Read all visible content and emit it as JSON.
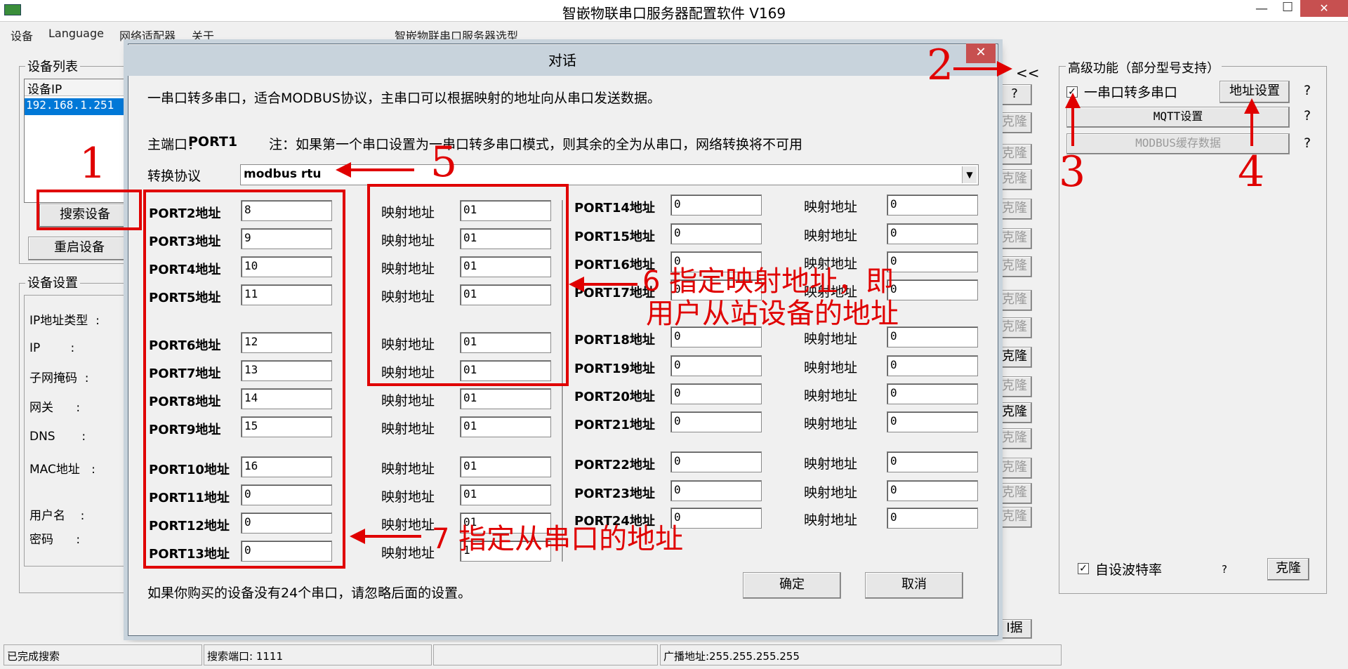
{
  "window": {
    "title": "智嵌物联串口服务器配置软件   V169",
    "controls": [
      "—",
      "☐",
      "✕"
    ]
  },
  "menu": {
    "items": [
      "设备",
      "Language",
      "网络适配器",
      "关于"
    ],
    "center_item": "智嵌物联串口服务器选型"
  },
  "left": {
    "device_list_label": "设备列表",
    "list_header": "设备IP",
    "device_ip": "192.168.1.251",
    "search_button": "搜索设备",
    "restart_button": "重启设备",
    "settings_label": "设备设置",
    "fields": [
      "IP地址类型  :",
      "IP        :",
      "子网掩码  :",
      "网关      :",
      "DNS       :",
      "MAC地址   :",
      "用户名    :",
      "密码      :"
    ]
  },
  "right": {
    "collapse_button": "<<",
    "advanced_label": "高级功能（部分型号支持）",
    "serial_to_multi_label": "一串口转多串口",
    "address_settings_button": "地址设置",
    "mqtt_button": "MQTT设置",
    "modbus_cache_button": "MODBUS缓存数据",
    "help": "?",
    "auto_baud_label": "自设波特率",
    "clone_button": "克隆",
    "clone_labels": [
      "?",
      "克隆",
      "克隆",
      "克隆",
      "克隆",
      "克隆",
      "克隆",
      "克隆",
      "克隆",
      "克隆",
      "克隆",
      "克隆",
      "克隆",
      "克隆",
      "克隆",
      "克隆"
    ],
    "data_button": "I据"
  },
  "dialog": {
    "title": "对话",
    "close": "✕",
    "description": "一串口转多串口，适合MODBUS协议，主串口可以根据映射的地址向从串口发送数据。",
    "main_port_label": "主端口：",
    "main_port_value": "PORT1",
    "main_port_note": "注：如果第一个串口设置为一串口转多串口模式，则其余的全为从串口，网络转换将不可用",
    "protocol_label": "转换协议",
    "protocol_value": "modbus rtu",
    "map_label": "映射地址",
    "left_ports": [
      {
        "label": "PORT2地址",
        "addr": "8",
        "map": "01"
      },
      {
        "label": "PORT3地址",
        "addr": "9",
        "map": "01"
      },
      {
        "label": "PORT4地址",
        "addr": "10",
        "map": "01"
      },
      {
        "label": "PORT5地址",
        "addr": "11",
        "map": "01"
      },
      {
        "label": "PORT6地址",
        "addr": "12",
        "map": "01"
      },
      {
        "label": "PORT7地址",
        "addr": "13",
        "map": "01"
      },
      {
        "label": "PORT8地址",
        "addr": "14",
        "map": "01"
      },
      {
        "label": "PORT9地址",
        "addr": "15",
        "map": "01"
      },
      {
        "label": "PORT10地址",
        "addr": "16",
        "map": "01"
      },
      {
        "label": "PORT11地址",
        "addr": "0",
        "map": "01"
      },
      {
        "label": "PORT12地址",
        "addr": "0",
        "map": "01"
      },
      {
        "label": "PORT13地址",
        "addr": "0",
        "map": "1"
      }
    ],
    "right_ports": [
      {
        "label": "PORT14地址",
        "addr": "0",
        "map": "0"
      },
      {
        "label": "PORT15地址",
        "addr": "0",
        "map": "0"
      },
      {
        "label": "PORT16地址",
        "addr": "0",
        "map": "0"
      },
      {
        "label": "PORT17地址",
        "addr": "0",
        "map": "0"
      },
      {
        "label": "PORT18地址",
        "addr": "0",
        "map": "0"
      },
      {
        "label": "PORT19地址",
        "addr": "0",
        "map": "0"
      },
      {
        "label": "PORT20地址",
        "addr": "0",
        "map": "0"
      },
      {
        "label": "PORT21地址",
        "addr": "0",
        "map": "0"
      },
      {
        "label": "PORT22地址",
        "addr": "0",
        "map": "0"
      },
      {
        "label": "PORT23地址",
        "addr": "0",
        "map": "0"
      },
      {
        "label": "PORT24地址",
        "addr": "0",
        "map": "0"
      }
    ],
    "footer_note": "如果你购买的设备没有24个串口，请忽略后面的设置。",
    "ok_button": "确定",
    "cancel_button": "取消"
  },
  "annotations": {
    "n1": "1",
    "n2": "2",
    "n3": "3",
    "n4": "4",
    "n5": "5",
    "n6_line1": "6  指定映射地址，即",
    "n6_line2": "用户从站设备的地址",
    "n7": "7  指定从串口的地址"
  },
  "status": {
    "left": "已完成搜索",
    "port": "搜索端口: 1111",
    "empty": "",
    "broadcast": "广播地址:255.255.255.255"
  },
  "colors": {
    "annotation": "#e00000",
    "selection": "#0078d7",
    "dialog_frame": "#c8d3dc"
  }
}
